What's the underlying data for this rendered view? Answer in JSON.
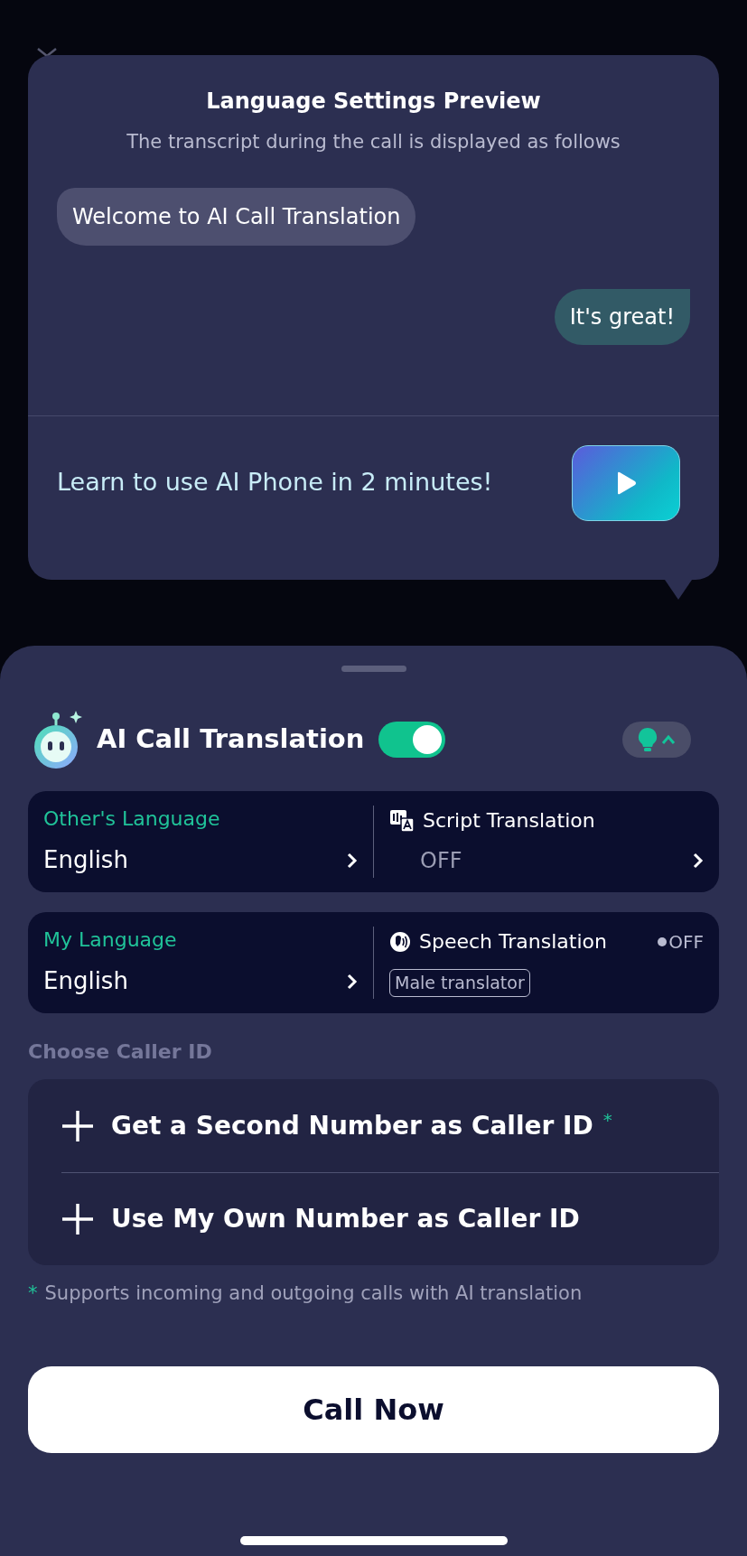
{
  "preview": {
    "title": "Language Settings Preview",
    "subtitle": "The transcript during the call is displayed as follows",
    "messages": [
      {
        "text": "Welcome to AI Call Translation",
        "kind": "received"
      },
      {
        "text": "It's great!",
        "kind": "sent"
      }
    ],
    "tutorial": {
      "text": "Learn to use AI Phone in 2 minutes!"
    }
  },
  "sheet": {
    "title": "AI Call Translation",
    "enabled": true,
    "settings": [
      {
        "label": "Other's Language",
        "value": "English",
        "option": {
          "kind": "script",
          "label": "Script Translation",
          "value": "OFF"
        }
      },
      {
        "label": "My Language",
        "value": "English",
        "option": {
          "kind": "speech",
          "label": "Speech Translation",
          "status": "OFF",
          "tag": "Male translator"
        }
      }
    ],
    "caller_id": {
      "heading": "Choose Caller ID",
      "options": [
        {
          "label": "Get a Second Number as Caller ID",
          "mark": "*"
        },
        {
          "label": "Use My Own Number as Caller ID"
        }
      ],
      "footnote": {
        "mark": "*",
        "text": "Supports incoming and outgoing calls with AI translation"
      }
    },
    "primary_button": "Call Now"
  }
}
